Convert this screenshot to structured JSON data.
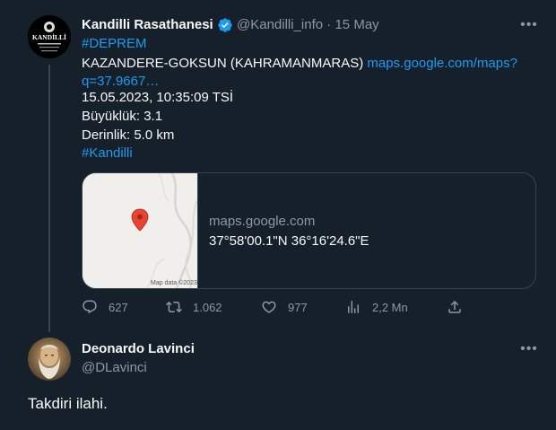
{
  "tweet": {
    "author_name": "Kandilli Rasathanesi",
    "handle": "@Kandilli_info",
    "separator": "·",
    "date": "15 May",
    "avatar_text": "KANDİLLİ",
    "hashtag_deprem": "#DEPREM",
    "location": "KAZANDERE-GOKSUN (KAHRAMANMARAS)",
    "link_line1": "maps.google.com/maps?",
    "link_line2": "q=37.9667…",
    "datetime": "15.05.2023, 10:35:09 TSİ",
    "magnitude": "Büyüklük: 3.1",
    "depth": "Derinlik: 5.0 km",
    "hashtag_kandilli": "#Kandilli",
    "card": {
      "domain": "maps.google.com",
      "title": "37°58'00.1\"N 36°16'24.6\"E",
      "map_credit": "Map data ©2023"
    },
    "actions": {
      "replies": "627",
      "retweets": "1.062",
      "likes": "977",
      "views": "2,2 Mn"
    }
  },
  "reply": {
    "author_name": "Deonardo Lavinci",
    "handle": "@DLavinci",
    "text": "Takdiri ilahi."
  },
  "colors": {
    "background": "#15202b",
    "accent": "#1d9bf0",
    "muted": "#8b98a5",
    "verified": "#1d9bf0",
    "map_pin": "#ea4335"
  }
}
